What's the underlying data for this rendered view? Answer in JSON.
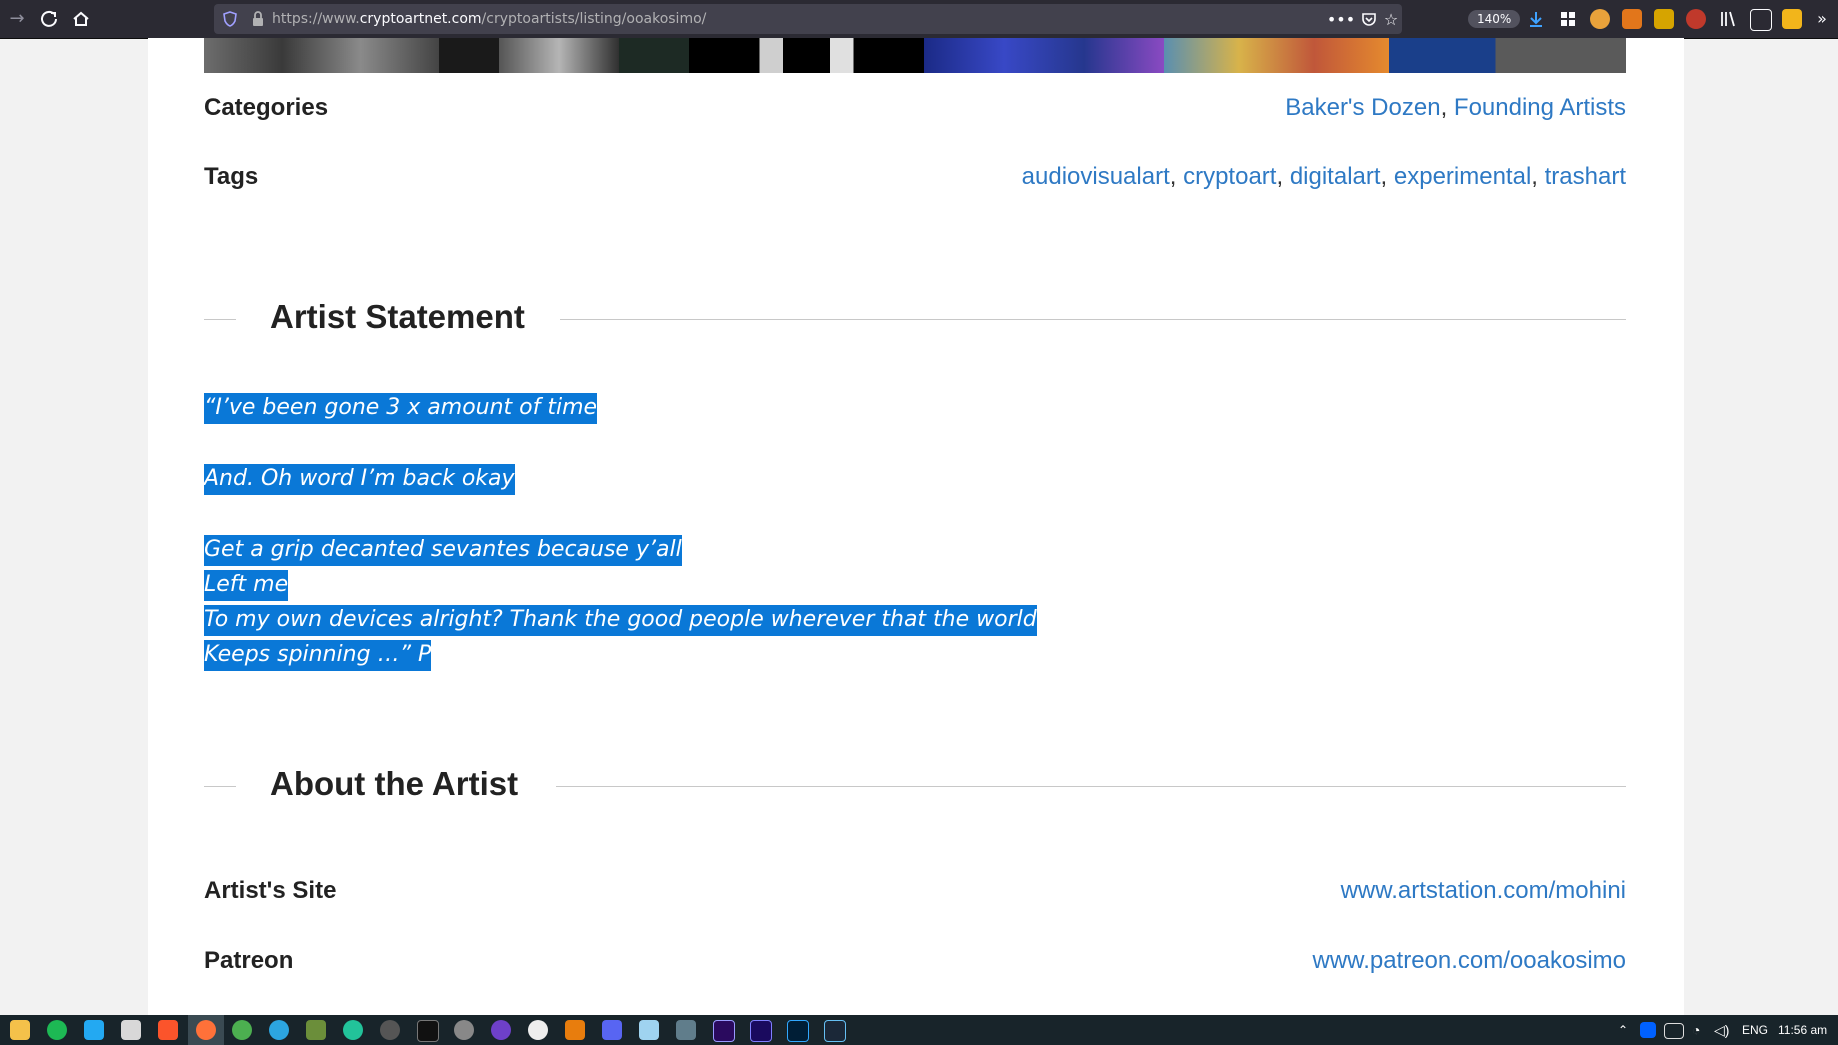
{
  "browser": {
    "url_prefix": "https://www.",
    "url_host": "cryptoartnet.com",
    "url_path": "/cryptoartists/listing/ooakosimo/",
    "zoom": "140%"
  },
  "listing": {
    "categories_label": "Categories",
    "categories": [
      "Baker's Dozen",
      "Founding Artists"
    ],
    "tags_label": "Tags",
    "tags": [
      "audiovisualart",
      "cryptoart",
      "digitalart",
      "experimental",
      "trashart"
    ]
  },
  "statement": {
    "heading": "Artist Statement",
    "lines": [
      "“I’ve been gone 3 x amount of time",
      "And. Oh word I’m back okay",
      "Get a grip decanted sevantes because y’all",
      "Left me",
      "To my own devices alright? Thank the good people wherever that the world",
      "Keeps spinning …” P"
    ]
  },
  "about": {
    "heading": "About the Artist",
    "site_label": "Artist's Site",
    "site_value": "www.artstation.com/mohini",
    "patreon_label": "Patreon",
    "patreon_value": "www.patreon.com/ooakosimo"
  },
  "taskbar": {
    "language": "ENG",
    "time": "11:56 am"
  },
  "colors": {
    "link": "#2e79c4",
    "selection": "#0a78d7",
    "toolbar": "#2b2a33",
    "taskbar": "#18242a"
  }
}
